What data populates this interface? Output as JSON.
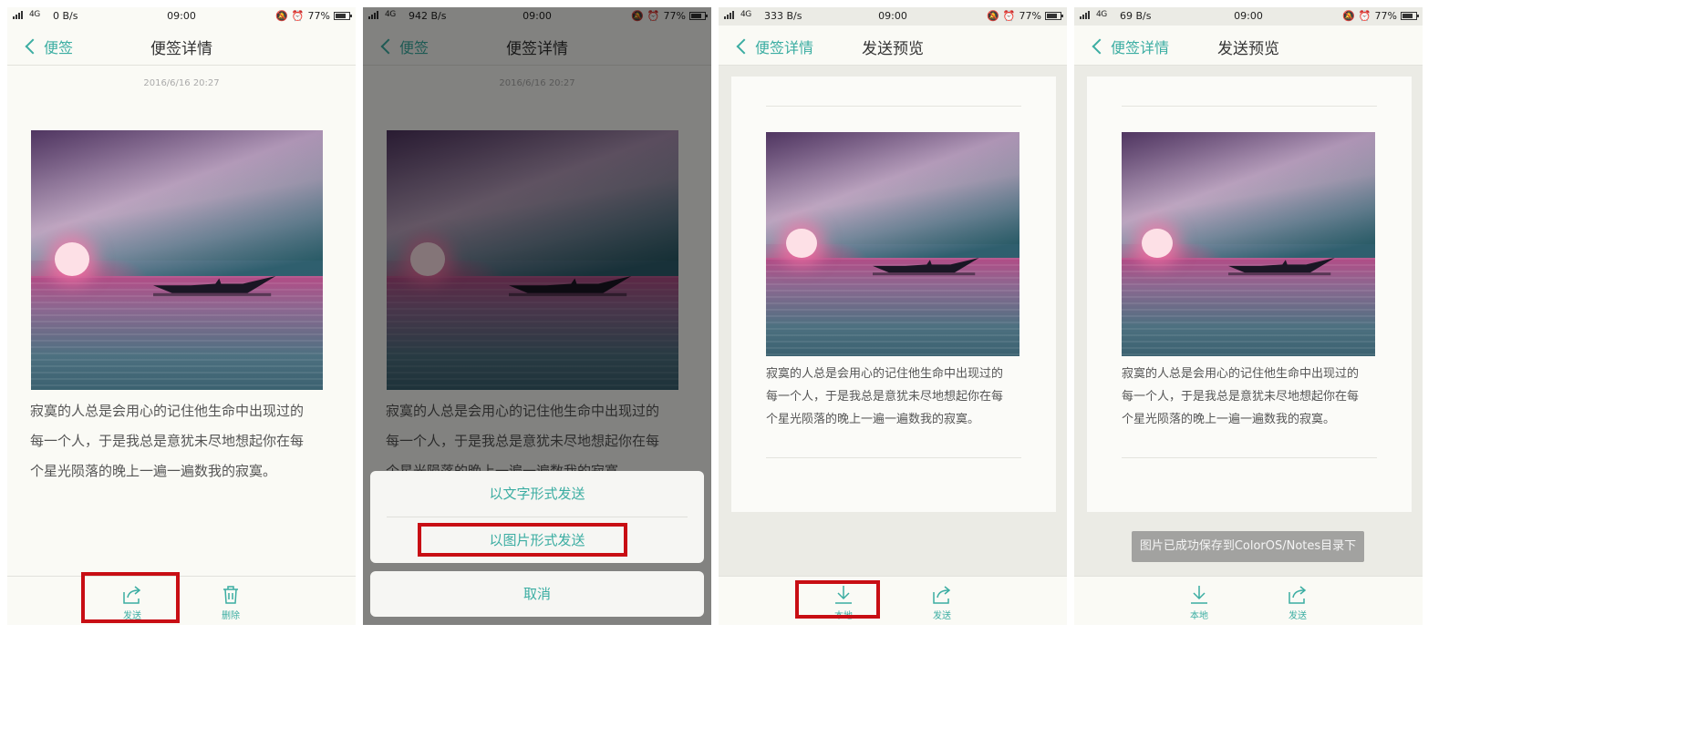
{
  "screens": [
    {
      "status": {
        "speed": "0 B/s",
        "time": "09:00",
        "battery": "77%"
      },
      "nav": {
        "back": "便签",
        "title": "便签详情"
      },
      "date": "2016/6/16 20:27",
      "note_lines": [
        "寂寞的人总是会用心的记住他生命中出现过的",
        "每一个人，于是我总是意犹未尽地想起你在每",
        "个星光陨落的晚上一遍一遍数我的寂寞。"
      ],
      "toolbar": {
        "send": "发送",
        "delete": "删除"
      }
    },
    {
      "status": {
        "speed": "942 B/s",
        "time": "09:00",
        "battery": "77%"
      },
      "nav": {
        "back": "便签",
        "title": "便签详情"
      },
      "date": "2016/6/16 20:27",
      "note_lines": [
        "寂寞的人总是会用心的记住他生命中出现过的",
        "每一个人，于是我总是意犹未尽地想起你在每",
        "个星光陨落的晚上一遍一遍数我的寂寞。"
      ],
      "sheet": {
        "text_option": "以文字形式发送",
        "image_option": "以图片形式发送",
        "cancel": "取消"
      }
    },
    {
      "status": {
        "speed": "333 B/s",
        "time": "09:00",
        "battery": "77%"
      },
      "nav": {
        "back": "便签详情",
        "title": "发送预览"
      },
      "note_lines": [
        "寂寞的人总是会用心的记住他生命中出现过的",
        "每一个人，于是我总是意犹未尽地想起你在每",
        "个星光陨落的晚上一遍一遍数我的寂寞。"
      ],
      "toolbar": {
        "local": "本地",
        "send": "发送"
      }
    },
    {
      "status": {
        "speed": "69 B/s",
        "time": "09:00",
        "battery": "77%"
      },
      "nav": {
        "back": "便签详情",
        "title": "发送预览"
      },
      "note_lines": [
        "寂寞的人总是会用心的记住他生命中出现过的",
        "每一个人，于是我总是意犹未尽地想起你在每",
        "个星光陨落的晚上一遍一遍数我的寂寞。"
      ],
      "toast": "图片已成功保存到ColorOS/Notes目录下",
      "toolbar": {
        "local": "本地",
        "send": "发送"
      }
    }
  ],
  "colors": {
    "accent": "#3bada2",
    "highlight": "#c80e14"
  }
}
